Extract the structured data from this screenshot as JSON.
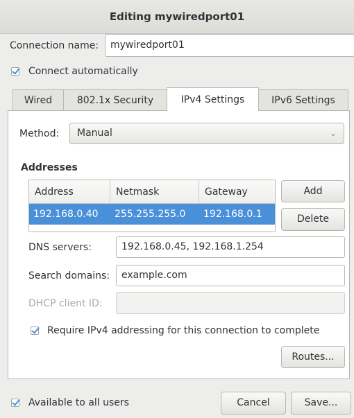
{
  "window": {
    "title": "Editing mywiredport01"
  },
  "connection_name": {
    "label": "Connection name:",
    "value": "mywiredport01"
  },
  "connect_automatically": {
    "label": "Connect automatically",
    "checked": true
  },
  "tabs": [
    {
      "label": "Wired",
      "active": false
    },
    {
      "label": "802.1x Security",
      "active": false
    },
    {
      "label": "IPv4 Settings",
      "active": true
    },
    {
      "label": "IPv6 Settings",
      "active": false
    }
  ],
  "method": {
    "label": "Method:",
    "value": "Manual"
  },
  "addresses": {
    "heading": "Addresses",
    "columns": [
      "Address",
      "Netmask",
      "Gateway"
    ],
    "rows": [
      {
        "address": "192.168.0.40",
        "netmask": "255.255.255.0",
        "gateway": "192.168.0.1"
      }
    ],
    "add_label": "Add",
    "delete_label": "Delete"
  },
  "dns": {
    "label": "DNS servers:",
    "value": "192.168.0.45, 192.168.1.254"
  },
  "search_domains": {
    "label": "Search domains:",
    "value": "example.com"
  },
  "dhcp_client_id": {
    "label": "DHCP client ID:",
    "value": ""
  },
  "require_ipv4": {
    "label": "Require IPv4 addressing for this connection to complete",
    "checked": true
  },
  "routes_label": "Routes...",
  "available_all_users": {
    "label": "Available to all users",
    "checked": true
  },
  "cancel_label": "Cancel",
  "save_label": "Save...",
  "colors": {
    "selection": "#4a90d9",
    "checkmark": "#4a90d9",
    "disabled_text": "#a9aaa6"
  }
}
